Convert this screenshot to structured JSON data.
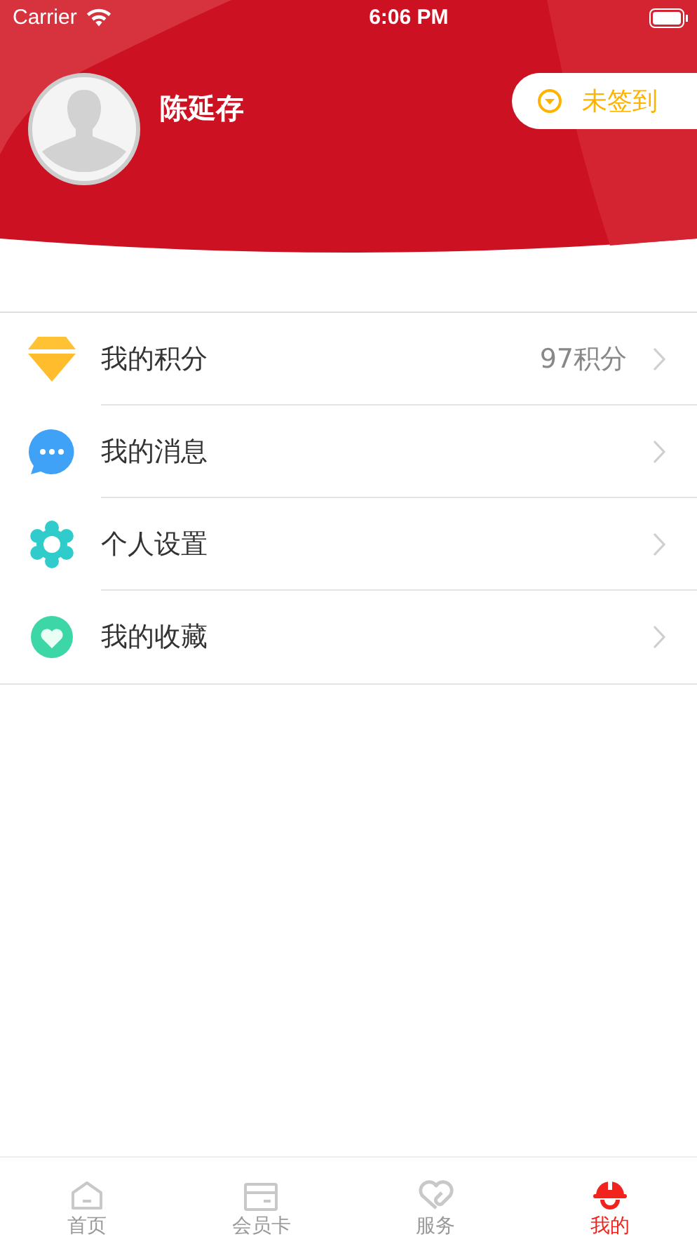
{
  "status_bar": {
    "carrier": "Carrier",
    "time": "6:06 PM"
  },
  "profile": {
    "name": "陈延存",
    "checkin": {
      "label": "未签到",
      "checked_in": false
    }
  },
  "menu": [
    {
      "label": "我的积分",
      "value": "97积分"
    },
    {
      "label": "我的消息"
    },
    {
      "label": "个人设置"
    },
    {
      "label": "我的收藏"
    }
  ],
  "tab_bar": [
    {
      "label": "首页",
      "selected": false
    },
    {
      "label": "会员卡",
      "selected": false
    },
    {
      "label": "服务",
      "selected": false
    },
    {
      "label": "我的",
      "selected": true
    }
  ]
}
